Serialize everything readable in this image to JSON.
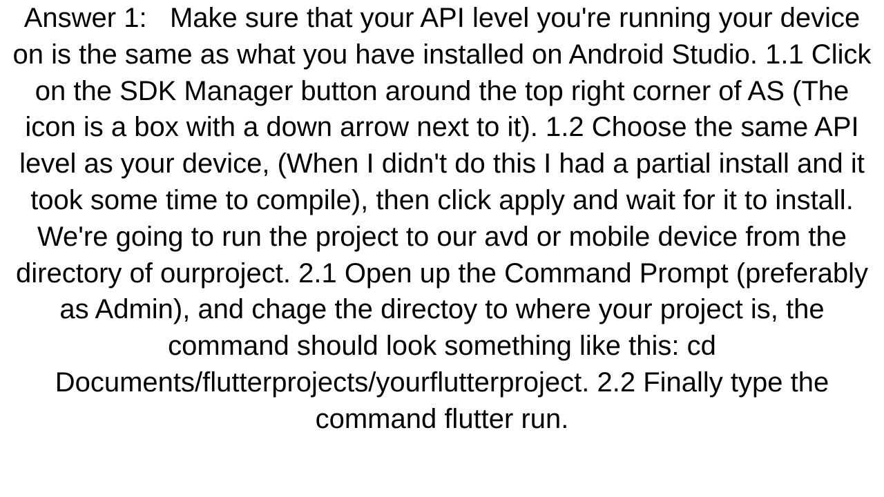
{
  "answer": {
    "label": "Answer 1:",
    "body": "Make sure that your API level you're running your device on is the same as what you have installed on Android Studio. 1.1 Click on the SDK Manager button around the top right corner of AS (The icon is a box with a down arrow next to it). 1.2 Choose the same API level as your device, (When I didn't do this I had a partial install and it took some time to compile), then click apply and wait for it to install.  We're going to run the project to our avd or mobile device from the directory of ourproject. 2.1 Open up the Command Prompt (preferably as Admin), and chage the directoy to where your project is, the command should look something like this:  cd Documents/flutterprojects/yourflutterproject.  2.2 Finally type the command flutter run."
  }
}
